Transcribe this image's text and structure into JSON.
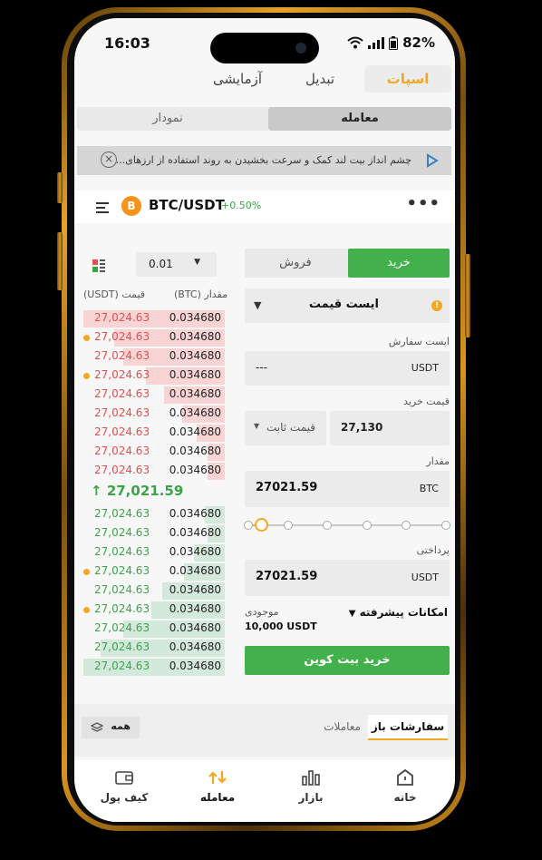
{
  "status": {
    "time": "16:03",
    "battery": "82%"
  },
  "top_tabs": {
    "spot": "اسپات",
    "convert": "تبدیل",
    "demo": "آزمایشی"
  },
  "view_tabs": {
    "trade": "معامله",
    "chart": "نمودار"
  },
  "banner": {
    "text": "چشم انداز بیت لند کمک و سرعت بخشیدن به روند استفاده از ارزهای..."
  },
  "pair": {
    "name": "BTC/USDT",
    "change": "+0.50%",
    "coin_letter": "B"
  },
  "orderbook": {
    "tick_size": "0.01",
    "header_price": "قیمت (USDT)",
    "header_qty": "مقدار (BTC)",
    "last_price": "27,021.59",
    "last_arrow": "↑",
    "asks": [
      {
        "price": "27,024.63",
        "qty": "0.034680",
        "depth": 1.0,
        "dot": false
      },
      {
        "price": "27,024.63",
        "qty": "0.034680",
        "depth": 0.78,
        "dot": true
      },
      {
        "price": "27,024.63",
        "qty": "0.034680",
        "depth": 0.72,
        "dot": false
      },
      {
        "price": "27,024.63",
        "qty": "0.034680",
        "depth": 0.56,
        "dot": true
      },
      {
        "price": "27,024.63",
        "qty": "0.034680",
        "depth": 0.43,
        "dot": false
      },
      {
        "price": "27,024.63",
        "qty": "0.034680",
        "depth": 0.3,
        "dot": false
      },
      {
        "price": "27,024.63",
        "qty": "0.034680",
        "depth": 0.2,
        "dot": false
      },
      {
        "price": "27,024.63",
        "qty": "0.034680",
        "depth": 0.12,
        "dot": false
      },
      {
        "price": "27,024.63",
        "qty": "0.034680",
        "depth": 0.12,
        "dot": false
      }
    ],
    "bids": [
      {
        "price": "27,024.63",
        "qty": "0.034680",
        "depth": 0.14,
        "dot": false
      },
      {
        "price": "27,024.63",
        "qty": "0.034680",
        "depth": 0.12,
        "dot": false
      },
      {
        "price": "27,024.63",
        "qty": "0.034680",
        "depth": 0.22,
        "dot": false
      },
      {
        "price": "27,024.63",
        "qty": "0.034680",
        "depth": 0.29,
        "dot": true
      },
      {
        "price": "27,024.63",
        "qty": "0.034680",
        "depth": 0.44,
        "dot": false
      },
      {
        "price": "27,024.63",
        "qty": "0.034680",
        "depth": 0.52,
        "dot": true
      },
      {
        "price": "27,024.63",
        "qty": "0.034680",
        "depth": 0.72,
        "dot": false
      },
      {
        "price": "27,024.63",
        "qty": "0.034680",
        "depth": 0.88,
        "dot": false
      },
      {
        "price": "27,024.63",
        "qty": "0.034680",
        "depth": 1.0,
        "dot": false
      }
    ]
  },
  "form": {
    "buy_tab": "خرید",
    "sell_tab": "فروش",
    "order_type": "ایست قیمت",
    "stop_label": "ایست سفارش",
    "stop_value": "---",
    "stop_unit": "USDT",
    "buy_price_label": "قیمت خرید",
    "price_mode": "قیمت ثابت",
    "price_value": "27,130",
    "amount_label": "مقدار",
    "amount_value": "27021.59",
    "amount_unit": "BTC",
    "slider_level": 0.07,
    "pay_label": "پرداختی",
    "pay_value": "27021.59",
    "pay_unit": "USDT",
    "advanced": "امکانات پیشرفته",
    "balance_label": "موجودی",
    "balance_value": "10,000 USDT",
    "buy_button": "خرید بیت کوین"
  },
  "orders_tabs": {
    "open": "سفارشات باز",
    "trades": "معاملات",
    "filter": "همه"
  },
  "nav": {
    "home": "خانه",
    "market": "بازار",
    "trade": "معامله",
    "wallet": "کیف پول"
  },
  "colors": {
    "accent": "#f5a623",
    "buy": "#43b14b",
    "ask": "#e84d4d",
    "bid": "#3aa548"
  }
}
